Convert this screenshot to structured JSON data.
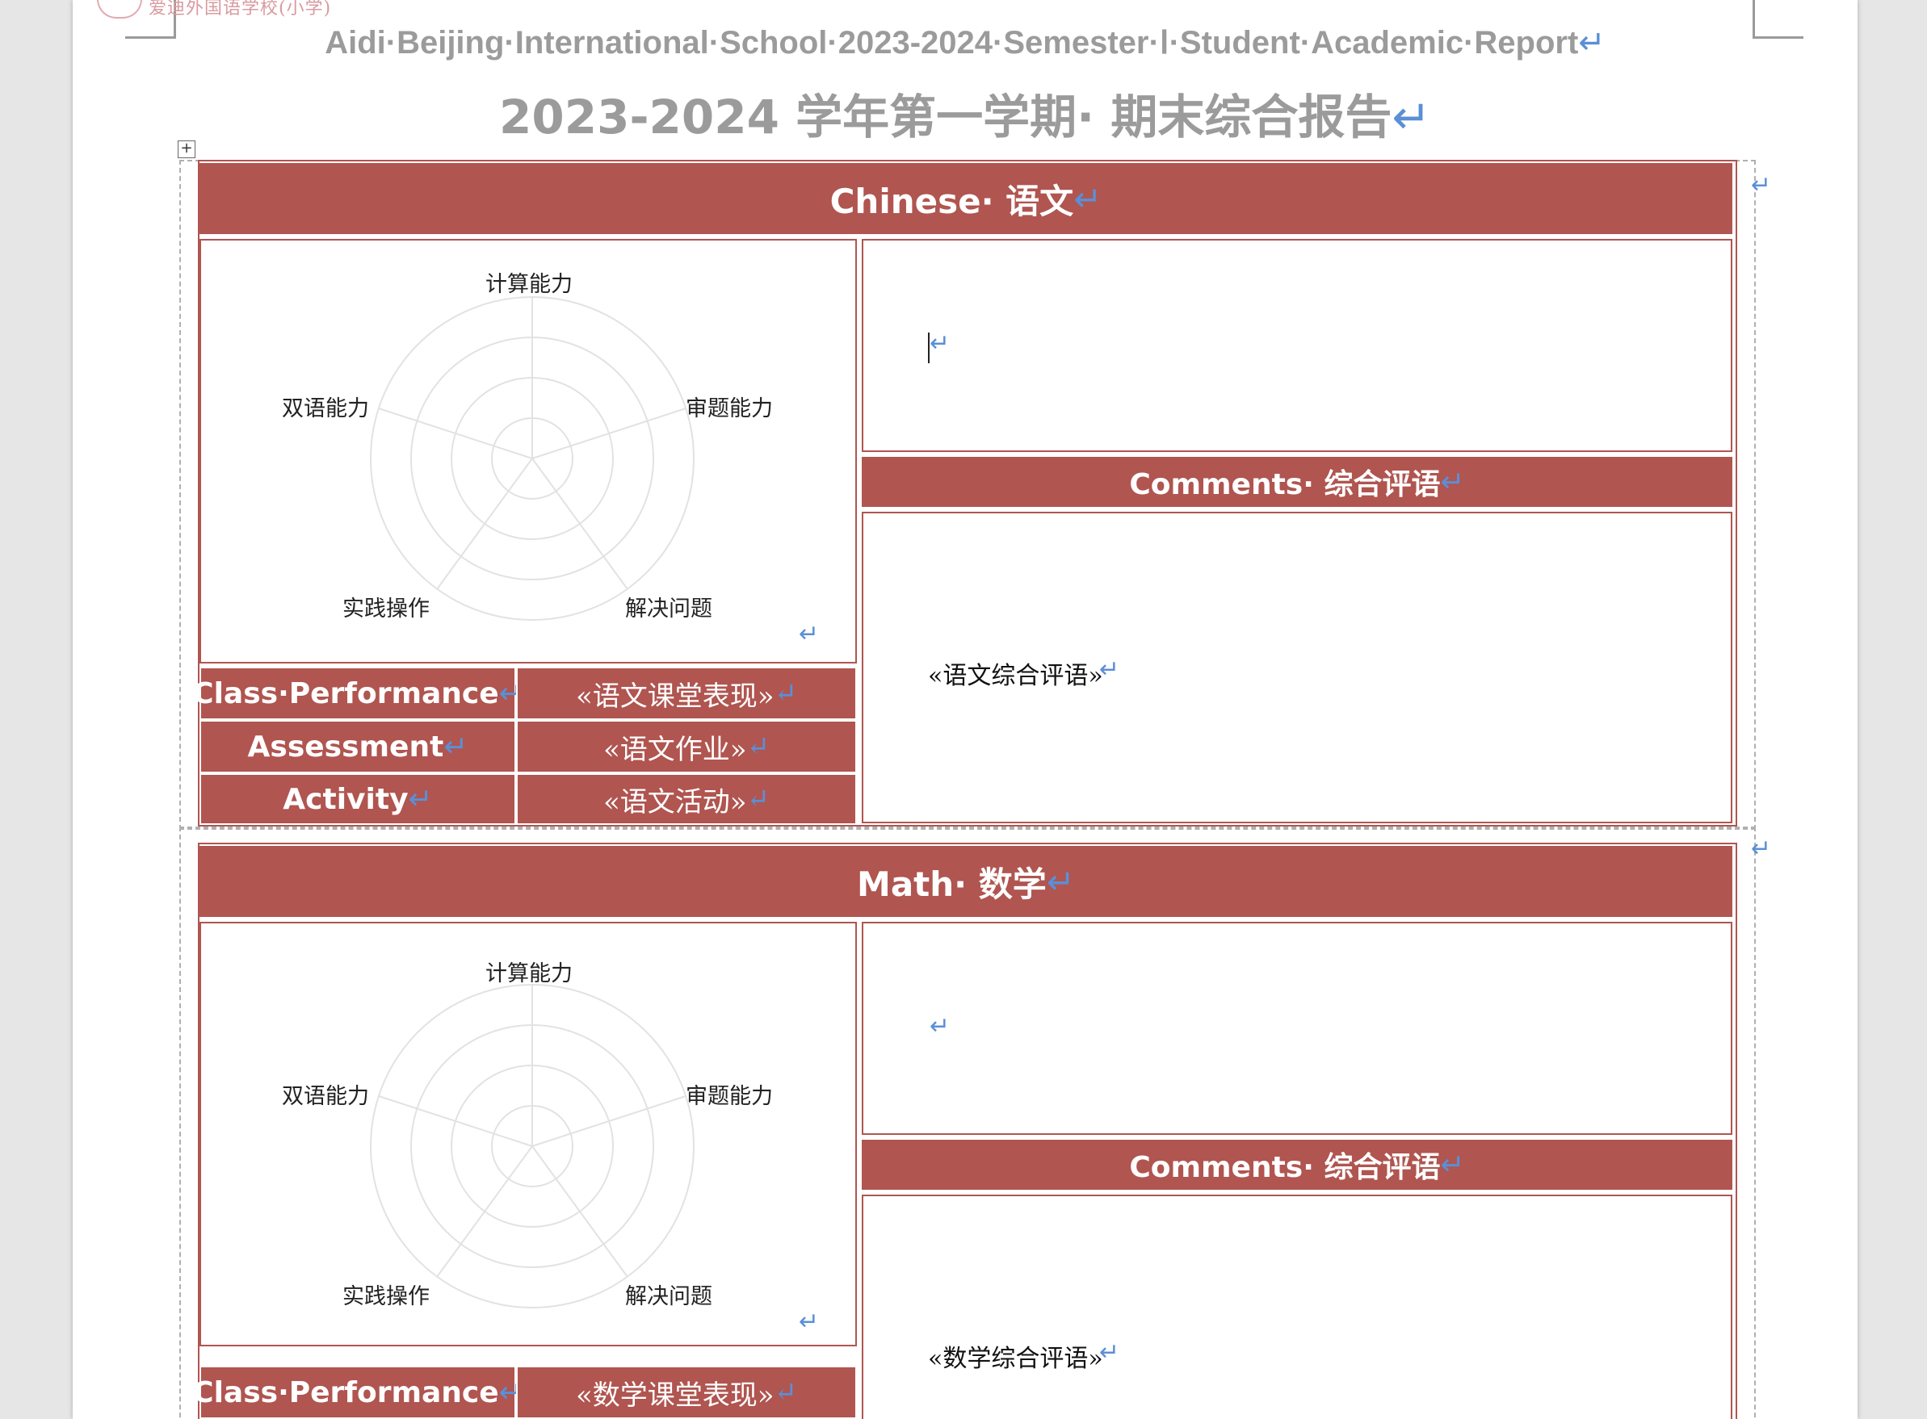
{
  "header": {
    "school_logo_text": "爱迪外国语学校(小学)",
    "title_en": "Aidi·Beijing·International·School·2023-2024·Semester·Ⅰ·Student·Academic·Report",
    "title_cn": "2023-2024 学年第一学期· 期末综合报告",
    "return_mark": "↵"
  },
  "subjects": [
    {
      "title": "Chinese· 语文",
      "radar_labels": [
        "计算能力",
        "审题能力",
        "解决问题",
        "实践操作",
        "双语能力"
      ],
      "comments_header": "Comments· 综合评语",
      "comments_value": "«语文综合评语»",
      "rows": [
        {
          "label": "Class·Performance",
          "value": "«语文课堂表现»"
        },
        {
          "label": "Assessment",
          "value": "«语文作业»"
        },
        {
          "label": "Activity",
          "value": "«语文活动»"
        }
      ]
    },
    {
      "title": "Math· 数学",
      "radar_labels": [
        "计算能力",
        "审题能力",
        "解决问题",
        "实践操作",
        "双语能力"
      ],
      "comments_header": "Comments· 综合评语",
      "comments_value": "«数学综合评语»",
      "rows": [
        {
          "label": "Class·Performance",
          "value": "«数学课堂表现»"
        }
      ]
    }
  ],
  "icons": {
    "move_handle": "move-handle-icon",
    "paragraph_mark": "paragraph-mark-icon"
  },
  "colors": {
    "accent": "#b05550",
    "title_gray": "#9b9b9b",
    "para_mark": "#5b8fd6"
  }
}
